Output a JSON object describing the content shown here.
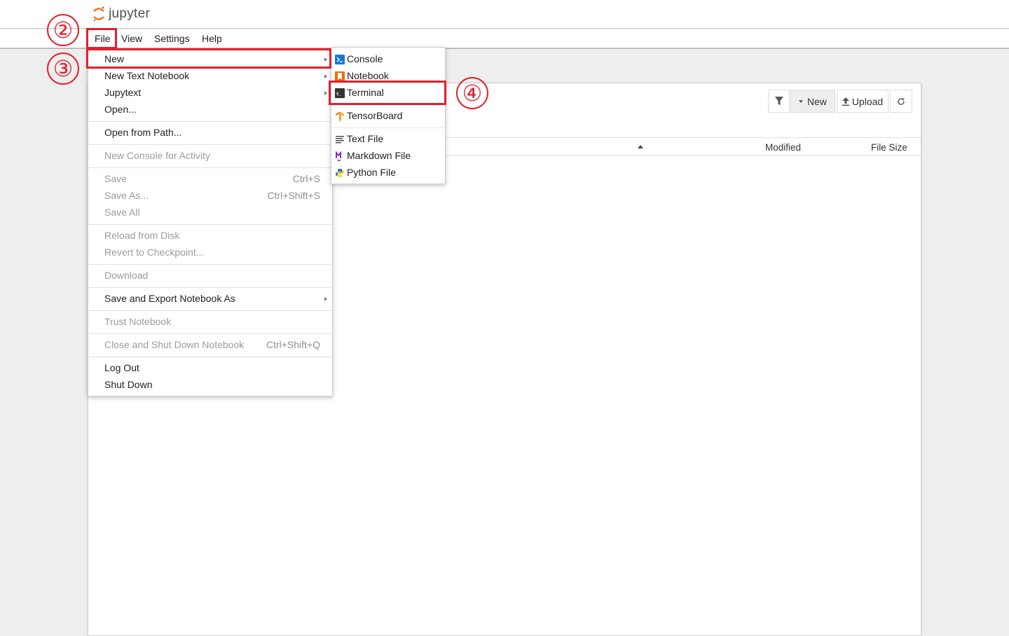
{
  "app": {
    "logo_text": "jupyter"
  },
  "menubar": {
    "items": [
      "File",
      "View",
      "Settings",
      "Help"
    ]
  },
  "file_menu": {
    "items": [
      {
        "label": "New",
        "shortcut": "",
        "submenu": true,
        "disabled": false
      },
      {
        "label": "New Text Notebook",
        "shortcut": "",
        "submenu": true,
        "disabled": false
      },
      {
        "label": "Jupytext",
        "shortcut": "",
        "submenu": true,
        "disabled": false
      },
      {
        "label": "Open...",
        "shortcut": "",
        "submenu": false,
        "disabled": false
      },
      {
        "label": "Open from Path...",
        "shortcut": "",
        "submenu": false,
        "disabled": false
      },
      {
        "label": "New Console for Activity",
        "shortcut": "",
        "submenu": false,
        "disabled": true
      },
      {
        "label": "Save",
        "shortcut": "Ctrl+S",
        "submenu": false,
        "disabled": true
      },
      {
        "label": "Save As...",
        "shortcut": "Ctrl+Shift+S",
        "submenu": false,
        "disabled": true
      },
      {
        "label": "Save All",
        "shortcut": "",
        "submenu": false,
        "disabled": true
      },
      {
        "label": "Reload from Disk",
        "shortcut": "",
        "submenu": false,
        "disabled": true
      },
      {
        "label": "Revert to Checkpoint...",
        "shortcut": "",
        "submenu": false,
        "disabled": true
      },
      {
        "label": "Download",
        "shortcut": "",
        "submenu": false,
        "disabled": true
      },
      {
        "label": "Save and Export Notebook As",
        "shortcut": "",
        "submenu": true,
        "disabled": false
      },
      {
        "label": "Trust Notebook",
        "shortcut": "",
        "submenu": false,
        "disabled": true
      },
      {
        "label": "Close and Shut Down Notebook",
        "shortcut": "Ctrl+Shift+Q",
        "submenu": false,
        "disabled": true
      },
      {
        "label": "Log Out",
        "shortcut": "",
        "submenu": false,
        "disabled": false
      },
      {
        "label": "Shut Down",
        "shortcut": "",
        "submenu": false,
        "disabled": false
      }
    ]
  },
  "new_submenu": {
    "items": [
      {
        "label": "Console",
        "icon": "console-icon"
      },
      {
        "label": "Notebook",
        "icon": "notebook-icon"
      },
      {
        "label": "Terminal",
        "icon": "terminal-icon"
      },
      {
        "label": "TensorBoard",
        "icon": "tensorboard-icon"
      },
      {
        "label": "Text File",
        "icon": "text-file-icon"
      },
      {
        "label": "Markdown File",
        "icon": "markdown-file-icon"
      },
      {
        "label": "Python File",
        "icon": "python-file-icon"
      }
    ]
  },
  "toolbar": {
    "filter_icon": "filter-icon",
    "new_label": "New",
    "upload_label": "Upload",
    "refresh_icon": "refresh-icon"
  },
  "file_list": {
    "columns": {
      "name": "",
      "modified": "Modified",
      "size": "File Size"
    }
  },
  "annotations": {
    "step_2": "②",
    "step_3": "③",
    "step_4": "④"
  },
  "colors": {
    "highlight": "#e3202b",
    "jupyter_orange": "#f37726"
  }
}
